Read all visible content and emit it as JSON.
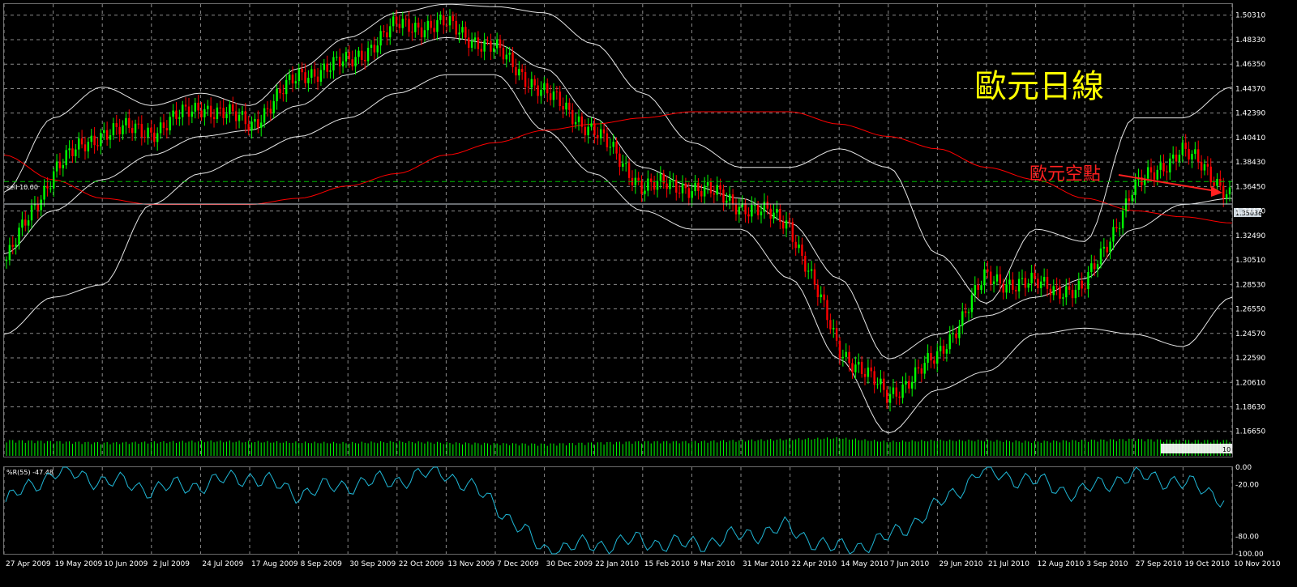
{
  "chart_title": "歐元日線",
  "annotation": "歐元空點",
  "order_line_label": "sell 10.00",
  "current_price_label": "1.35036",
  "indicator_label": "%R(55) -47.48",
  "volume_label": "10",
  "colors": {
    "background": "#000000",
    "grid": "#8a8a8a",
    "bull": "#00ff00",
    "bear": "#ff0000",
    "bands": "#e6e6e6",
    "ma": "#ff0000",
    "order_line": "#00c000",
    "indicator": "#1fb7d6",
    "title": "#ffff00",
    "annotation": "#ff2020",
    "volume": "#00ff00"
  },
  "chart_data": {
    "type": "candlestick",
    "y_ticks": [
      "1.50310",
      "1.48330",
      "1.46350",
      "1.44370",
      "1.42390",
      "1.40410",
      "1.38430",
      "1.36450",
      "1.34470",
      "1.32490",
      "1.30510",
      "1.28530",
      "1.26550",
      "1.24570",
      "1.22590",
      "1.20610",
      "1.18630",
      "1.16650"
    ],
    "y_range": [
      1.1565,
      1.5121
    ],
    "x_ticks": [
      "27 Apr 2009",
      "19 May 2009",
      "10 Jun 2009",
      "2 Jul 2009",
      "24 Jul 2009",
      "17 Aug 2009",
      "8 Sep 2009",
      "30 Sep 2009",
      "22 Oct 2009",
      "13 Nov 2009",
      "7 Dec 2009",
      "30 Dec 2009",
      "22 Jan 2010",
      "15 Feb 2010",
      "9 Mar 2010",
      "31 Mar 2010",
      "22 Apr 2010",
      "14 May 2010",
      "7 Jun 2010",
      "29 Jun 2010",
      "21 Jul 2010",
      "12 Aug 2010",
      "3 Sep 2010",
      "27 Sep 2010",
      "19 Oct 2010",
      "10 Nov 2010"
    ],
    "close_path": [
      [
        "27 Apr 2009",
        1.305
      ],
      [
        "19 May 2009",
        1.38
      ],
      [
        "10 Jun 2009",
        1.41
      ],
      [
        "2 Jul 2009",
        1.41
      ],
      [
        "24 Jul 2009",
        1.43
      ],
      [
        "17 Aug 2009",
        1.415
      ],
      [
        "8 Sep 2009",
        1.455
      ],
      [
        "30 Sep 2009",
        1.465
      ],
      [
        "22 Oct 2009",
        1.495
      ],
      [
        "13 Nov 2009",
        1.495
      ],
      [
        "7 Dec 2009",
        1.475
      ],
      [
        "30 Dec 2009",
        1.44
      ],
      [
        "22 Jan 2010",
        1.41
      ],
      [
        "15 Feb 2010",
        1.365
      ],
      [
        "9 Mar 2010",
        1.365
      ],
      [
        "31 Mar 2010",
        1.35
      ],
      [
        "22 Apr 2010",
        1.335
      ],
      [
        "14 May 2010",
        1.235
      ],
      [
        "7 Jun 2010",
        1.195
      ],
      [
        "29 Jun 2010",
        1.225
      ],
      [
        "21 Jul 2010",
        1.29
      ],
      [
        "12 Aug 2010",
        1.285
      ],
      [
        "3 Sep 2010",
        1.28
      ],
      [
        "27 Sep 2010",
        1.36
      ],
      [
        "19 Oct 2010",
        1.395
      ],
      [
        "10 Nov 2010",
        1.36
      ]
    ],
    "upper_band": [
      1.36,
      1.42,
      1.445,
      1.43,
      1.44,
      1.43,
      1.46,
      1.485,
      1.505,
      1.512,
      1.51,
      1.505,
      1.48,
      1.44,
      1.4,
      1.38,
      1.38,
      1.395,
      1.38,
      1.31,
      1.27,
      1.33,
      1.32,
      1.42,
      1.42,
      1.445
    ],
    "middle_band": [
      1.31,
      1.345,
      1.37,
      1.39,
      1.405,
      1.41,
      1.43,
      1.455,
      1.475,
      1.485,
      1.48,
      1.46,
      1.42,
      1.38,
      1.365,
      1.355,
      1.335,
      1.29,
      1.225,
      1.245,
      1.26,
      1.275,
      1.29,
      1.33,
      1.35,
      1.355
    ],
    "lower_band": [
      1.245,
      1.275,
      1.285,
      1.35,
      1.375,
      1.39,
      1.405,
      1.42,
      1.44,
      1.455,
      1.455,
      1.41,
      1.375,
      1.345,
      1.33,
      1.33,
      1.29,
      1.225,
      1.165,
      1.2,
      1.215,
      1.245,
      1.25,
      1.245,
      1.235,
      1.275
    ],
    "ma": [
      1.39,
      1.37,
      1.355,
      1.35,
      1.35,
      1.35,
      1.355,
      1.365,
      1.375,
      1.39,
      1.4,
      1.41,
      1.415,
      1.42,
      1.425,
      1.425,
      1.425,
      1.415,
      1.405,
      1.395,
      1.38,
      1.37,
      1.355,
      1.345,
      1.34,
      1.335
    ],
    "order_line_price": 1.3685,
    "current_price": 1.35036,
    "indicator": {
      "name": "%R(55)",
      "value": -47.48,
      "ticks": [
        "0.00",
        "-20.00",
        "-80.00",
        "-100.00"
      ],
      "values": [
        -40,
        -5,
        -15,
        -25,
        -20,
        -10,
        -30,
        -20,
        -15,
        -5,
        -40,
        -95,
        -90,
        -85,
        -90,
        -80,
        -70,
        -95,
        -85,
        -50,
        -5,
        -15,
        -30,
        -10,
        -15,
        -35
      ]
    },
    "volume": [
      0.55,
      0.5,
      0.45,
      0.48,
      0.52,
      0.5,
      0.47,
      0.45,
      0.5,
      0.45,
      0.42,
      0.4,
      0.45,
      0.5,
      0.5,
      0.55,
      0.6,
      0.65,
      0.5,
      0.55,
      0.55,
      0.5,
      0.55,
      0.6,
      0.55,
      0.55
    ]
  }
}
